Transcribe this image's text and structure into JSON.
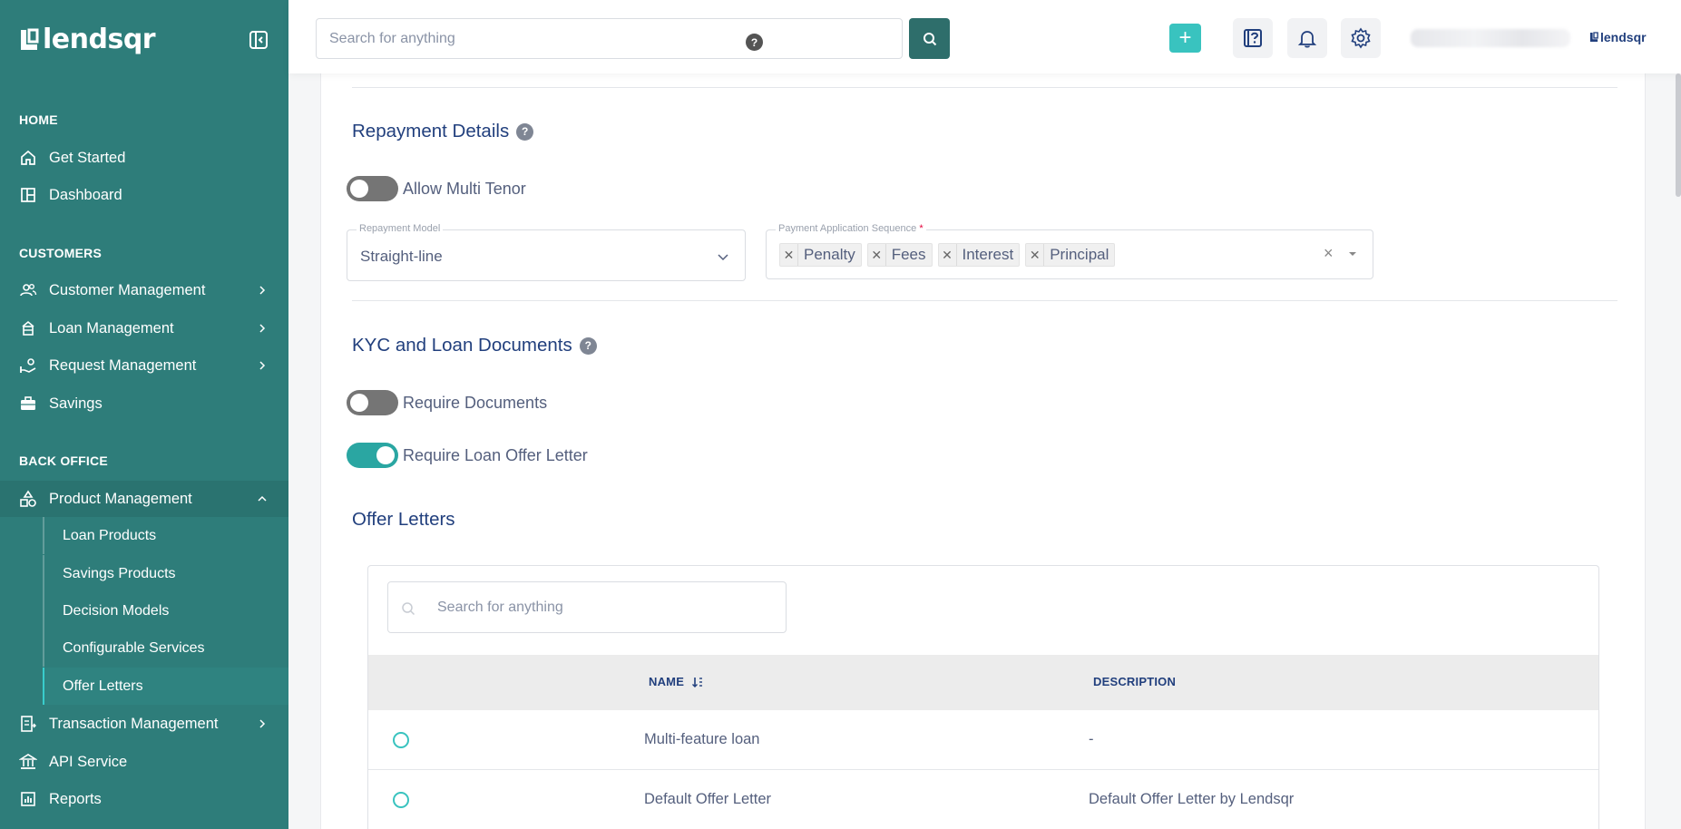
{
  "brand": {
    "name": "lendsqr",
    "accent": "#39cdcc",
    "sidebar_bg": "#2e7d7a"
  },
  "topbar": {
    "search_placeholder": "Search for anything",
    "search_help": "?",
    "plus": "+",
    "mini_logo": "lendsqr"
  },
  "sidebar": {
    "home_title": "HOME",
    "home_items": [
      {
        "label": "Get Started",
        "icon": "home-icon"
      },
      {
        "label": "Dashboard",
        "icon": "dashboard-icon"
      }
    ],
    "customers_title": "CUSTOMERS",
    "customer_items": [
      {
        "label": "Customer Management",
        "icon": "users-icon"
      },
      {
        "label": "Loan Management",
        "icon": "loan-icon"
      },
      {
        "label": "Request Management",
        "icon": "request-icon"
      },
      {
        "label": "Savings",
        "icon": "briefcase-icon"
      }
    ],
    "backoffice_title": "BACK OFFICE",
    "backoffice_items": [
      {
        "label": "Product Management",
        "icon": "product-icon"
      },
      {
        "label": "Transaction Management",
        "icon": "transaction-icon"
      },
      {
        "label": "API Service",
        "icon": "bank-icon"
      },
      {
        "label": "Reports",
        "icon": "reports-icon"
      }
    ],
    "product_sub_items": [
      {
        "label": "Loan Products"
      },
      {
        "label": "Savings Products"
      },
      {
        "label": "Decision Models"
      },
      {
        "label": "Configurable Services"
      },
      {
        "label": "Offer Letters"
      }
    ]
  },
  "repayment": {
    "title": "Repayment Details",
    "help": "?",
    "multi_tenor_label": "Allow Multi Tenor",
    "model_label": "Repayment Model",
    "model_value": "Straight-line",
    "sequence_label": "Payment Application Sequence",
    "sequence_required": "*",
    "sequence_tags": [
      "Penalty",
      "Fees",
      "Interest",
      "Principal"
    ],
    "clear": "×"
  },
  "kyc": {
    "title": "KYC and Loan Documents",
    "help": "?",
    "require_documents_label": "Require Documents",
    "require_offer_letter_label": "Require Loan Offer Letter"
  },
  "offer_letters": {
    "title": "Offer Letters",
    "search_placeholder": "Search for anything",
    "columns": {
      "name": "NAME",
      "description": "DESCRIPTION"
    },
    "rows": [
      {
        "name": "Multi-feature loan",
        "description": "-"
      },
      {
        "name": "Default Offer Letter",
        "description": "Default Offer Letter by Lendsqr"
      }
    ]
  }
}
